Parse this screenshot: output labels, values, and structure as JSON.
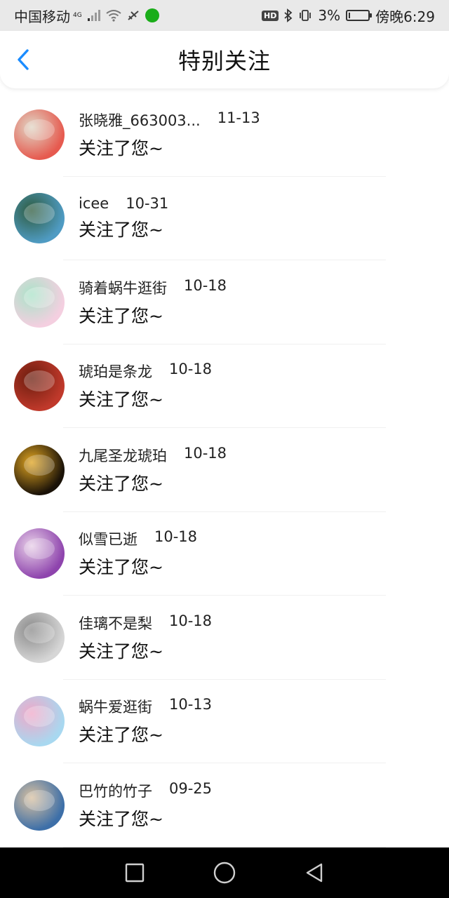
{
  "status_bar": {
    "carrier": "中国移动",
    "network": "4G",
    "battery": "3%",
    "time": "傍晚6:29",
    "hd_label": "HD"
  },
  "header": {
    "title": "特别关注",
    "back_icon": "chevron-left-icon",
    "accent_color": "#1a8cff"
  },
  "list": {
    "items": [
      {
        "name": "张晓雅_663003...",
        "date": "11-13",
        "message": "关注了您~",
        "avatar_colors": [
          "#e65a4f",
          "#e0d6c5"
        ]
      },
      {
        "name": "icee",
        "date": "10-31",
        "message": "关注了您~",
        "avatar_colors": [
          "#4f9bc3",
          "#2e5b3e"
        ]
      },
      {
        "name": "骑着蜗牛逛街",
        "date": "10-18",
        "message": "关注了您~",
        "avatar_colors": [
          "#f4cfe0",
          "#a9e3c8"
        ]
      },
      {
        "name": "琥珀是条龙",
        "date": "10-18",
        "message": "关注了您~",
        "avatar_colors": [
          "#c0392b",
          "#6b1d0e"
        ]
      },
      {
        "name": "九尾圣龙琥珀",
        "date": "10-18",
        "message": "关注了您~",
        "avatar_colors": [
          "#1a1208",
          "#e0a420"
        ]
      },
      {
        "name": "似雪已逝",
        "date": "10-18",
        "message": "关注了您~",
        "avatar_colors": [
          "#8e44ad",
          "#e8d0e8"
        ]
      },
      {
        "name": "佳璃不是梨",
        "date": "10-18",
        "message": "关注了您~",
        "avatar_colors": [
          "#d6d6d6",
          "#8a8a8a"
        ]
      },
      {
        "name": "蜗牛爱逛街",
        "date": "10-13",
        "message": "关注了您~",
        "avatar_colors": [
          "#a8d8f0",
          "#f0a8c8"
        ]
      },
      {
        "name": "巴竹的竹子",
        "date": "09-25",
        "message": "关注了您~",
        "avatar_colors": [
          "#3d6fa8",
          "#d8c0a0"
        ]
      }
    ]
  },
  "nav_bar": {
    "recent_icon": "square-recent-apps-icon",
    "home_icon": "circle-home-icon",
    "back_icon": "triangle-back-icon"
  }
}
